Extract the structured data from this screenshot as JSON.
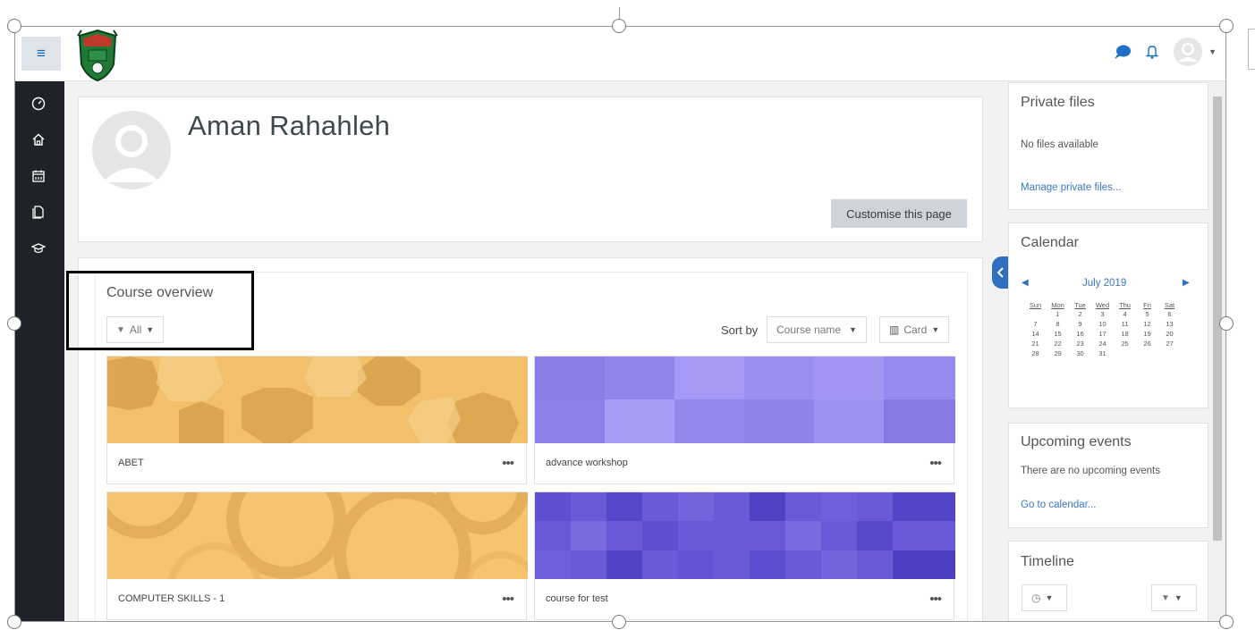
{
  "header": {
    "menu_icon": "hamburger-icon",
    "logo": "university-crest-logo",
    "messages_icon": "chat-bubble-icon",
    "notifications_icon": "bell-icon",
    "user_menu_icon": "user-avatar-icon",
    "accent_color": "#0f6cbf"
  },
  "drawer": {
    "items": [
      {
        "icon": "dashboard-icon"
      },
      {
        "icon": "home-icon"
      },
      {
        "icon": "calendar-icon"
      },
      {
        "icon": "private-files-icon"
      },
      {
        "icon": "my-courses-icon"
      }
    ]
  },
  "profile": {
    "name": "Aman Rahahleh",
    "customise_button": "Customise this page"
  },
  "course_overview": {
    "title": "Course overview",
    "filter_label": "All",
    "sort_by_label": "Sort by",
    "sort_value": "Course name",
    "view_value": "Card",
    "courses": [
      {
        "name": "ABET",
        "color": "#f2c06b"
      },
      {
        "name": "advance workshop",
        "color": "#9b8ef0"
      },
      {
        "name": "COMPUTER SKILLS - 1",
        "color": "#f4c470"
      },
      {
        "name": "course for test",
        "color": "#6a5ad8"
      }
    ]
  },
  "private_files": {
    "title": "Private files",
    "empty_text": "No files available",
    "manage_link": "Manage private files..."
  },
  "calendar": {
    "title": "Calendar",
    "month": "July 2019",
    "days": [
      "Sun",
      "Mon",
      "Tue",
      "Wed",
      "Thu",
      "Fri",
      "Sat"
    ],
    "weeks": [
      [
        "",
        "1",
        "2",
        "3",
        "4",
        "5",
        "6"
      ],
      [
        "7",
        "8",
        "9",
        "10",
        "11",
        "12",
        "13"
      ],
      [
        "14",
        "15",
        "16",
        "17",
        "18",
        "19",
        "20"
      ],
      [
        "21",
        "22",
        "23",
        "24",
        "25",
        "26",
        "27"
      ],
      [
        "28",
        "29",
        "30",
        "31",
        "",
        "",
        ""
      ]
    ]
  },
  "upcoming_events": {
    "title": "Upcoming events",
    "empty_text": "There are no upcoming events",
    "calendar_link": "Go to calendar..."
  },
  "timeline": {
    "title": "Timeline",
    "clock_icon": "clock-icon",
    "filter_icon": "filter-icon"
  }
}
